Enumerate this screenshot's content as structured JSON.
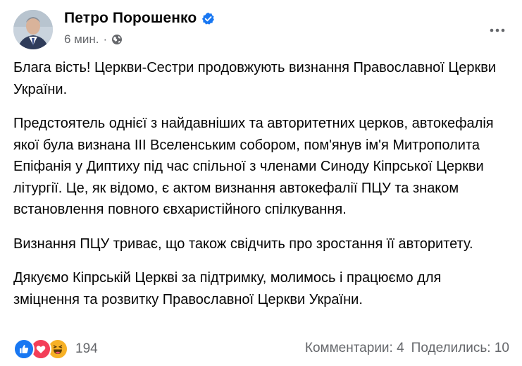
{
  "post": {
    "author": "Петро Порошенко",
    "time": "6 мин.",
    "separator": "·",
    "paragraphs": [
      "Блага вість! Церкви-Сестри продовжують визнання Православної Церкви України.",
      "Предстоятель однієї з найдавніших та авторитетних церков, автокефалія якої була визнана ІІІ Вселенським собором, пом'янув ім'я Митрополита Епіфанія у Диптиху під час спільної з членами Синоду Кіпрської Церкви літургії. Це, як відомо, є актом визнання автокефалії ПЦУ та знаком встановлення повного євхаристійного спілкування.",
      "Визнання ПЦУ триває, що також свідчить про зростання її авторитету.",
      "Дякуємо Кіпрській Церкві за підтримку, молимось і працюємо для зміцнення та розвитку Православної Церкви України."
    ]
  },
  "footer": {
    "reaction_count": "194",
    "comments": "Комментарии: 4",
    "shares": "Поделились: 10"
  },
  "icons": {
    "verified": "verified-badge-icon",
    "audience": "globe-icon",
    "more": "more-options-icon",
    "reactions": [
      "like-icon",
      "love-icon",
      "haha-icon"
    ]
  },
  "colors": {
    "verified": "#1877f2",
    "secondary_text": "#65676b",
    "like": "#1877f2",
    "love": "#f33e58",
    "haha": "#f7b125"
  }
}
